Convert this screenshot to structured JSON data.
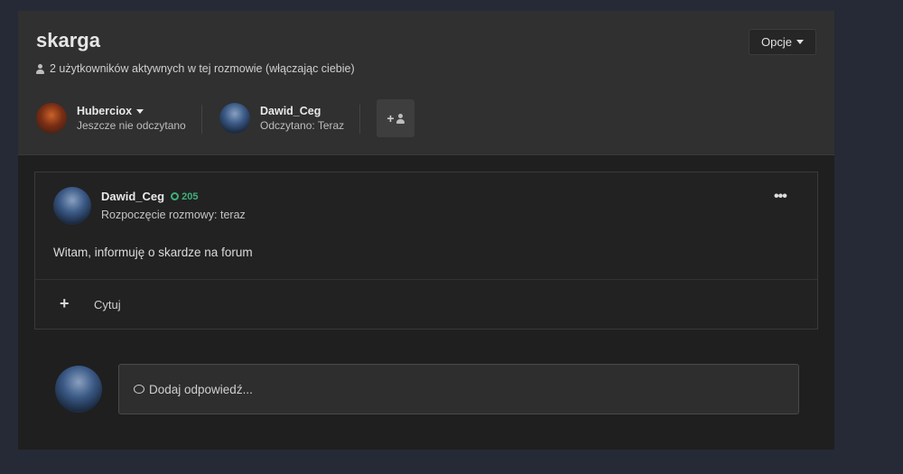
{
  "conversation": {
    "title": "skarga",
    "active_users_text": "2 użytkowników aktywnych w tej rozmowie (włączając ciebie)",
    "options_label": "Opcje"
  },
  "participants": [
    {
      "name": "Huberciox",
      "status": "Jeszcze nie odczytano",
      "has_dropdown": true
    },
    {
      "name": "Dawid_Ceg",
      "status": "Odczytano: Teraz",
      "has_dropdown": false
    }
  ],
  "add_participant_icon": "add-user-icon",
  "post": {
    "author": "Dawid_Ceg",
    "reputation": "205",
    "date": "Rozpoczęcie rozmowy: teraz",
    "body": "Witam, informuję o skardze na forum",
    "menu_icon": "•••",
    "quote_label": "Cytuj",
    "plus_icon": "+"
  },
  "reply": {
    "placeholder": "Dodaj odpowiedź..."
  },
  "colors": {
    "background": "#252a36",
    "panel": "#1f1f1f",
    "header": "#303030",
    "reputation": "#3fb07a"
  }
}
